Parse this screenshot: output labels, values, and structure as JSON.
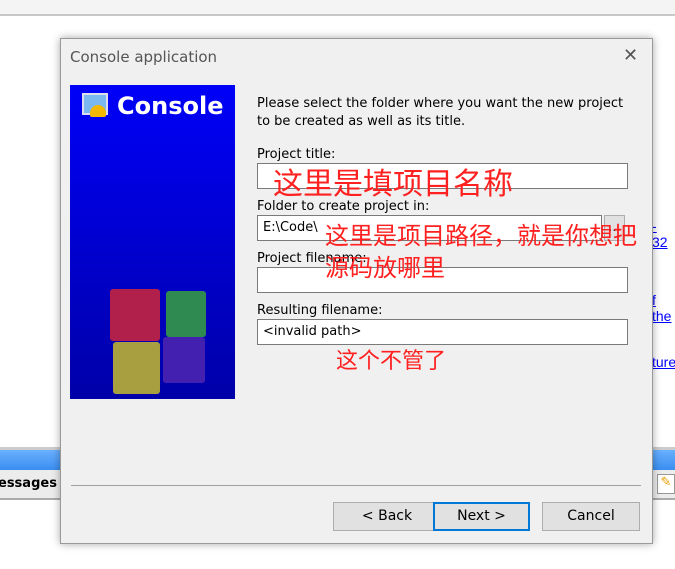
{
  "background": {
    "messages_tab": "essages",
    "links": [
      "- 32",
      "f the",
      "ture"
    ]
  },
  "dialog": {
    "title": "Console application",
    "close_icon": "close-icon",
    "panel": {
      "title": "Console",
      "icon": "console-wizard-icon"
    },
    "intro": "Please select the folder where you want the new project to be created as well as its title.",
    "project_title": {
      "label": "Project title:",
      "value": ""
    },
    "folder": {
      "label": "Folder to create project in:",
      "value": "E:\\Code\\",
      "browse": "..."
    },
    "filename": {
      "label": "Project filename:",
      "value": ""
    },
    "result": {
      "label": "Resulting filename:",
      "value": "<invalid path>"
    },
    "buttons": {
      "back": "< Back",
      "next": "Next >",
      "cancel": "Cancel"
    }
  },
  "annotations": {
    "title_note": "这里是填项目名称",
    "folder_note_1": "这里是项目路径，就是你想把",
    "folder_note_2": "源码放哪里",
    "result_note": "这个不管了"
  }
}
